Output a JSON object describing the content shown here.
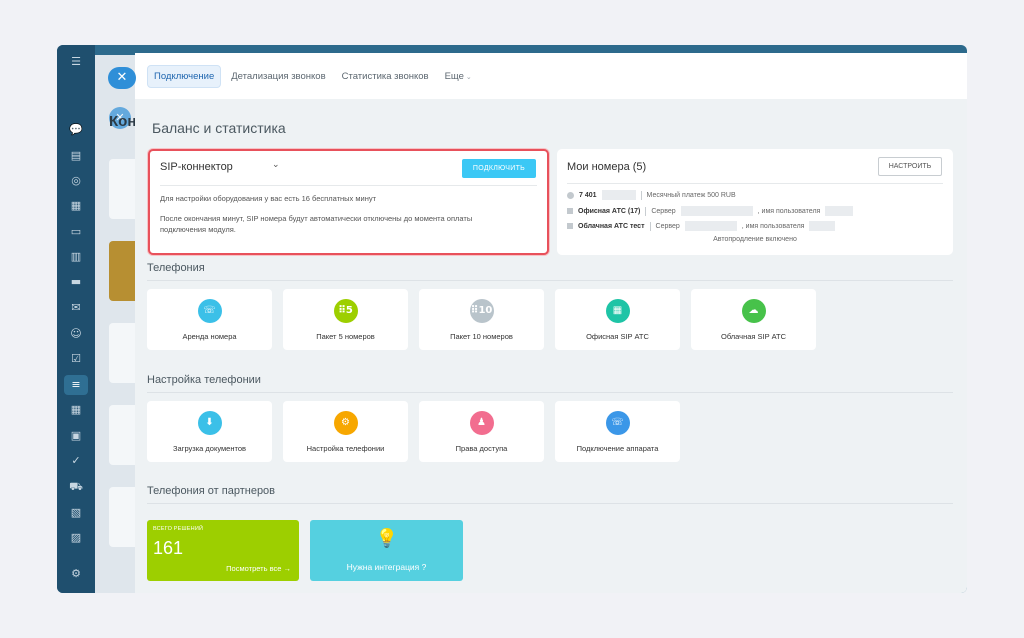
{
  "sidebar": {
    "icons": [
      "menu-icon",
      "chat-icon",
      "feed-icon",
      "target-icon",
      "calendar-icon",
      "document-icon",
      "chart-icon",
      "card-icon",
      "mail-icon",
      "contacts-icon",
      "tasks-icon",
      "telephony-icon",
      "schedule-icon",
      "store-icon",
      "tick-icon",
      "cart-icon",
      "media-icon",
      "export-icon",
      "settings-icon"
    ],
    "glyphs": [
      "☰",
      "💬",
      "▤",
      "◎",
      "▦",
      "▭",
      "▥",
      "▬",
      "✉",
      "☺",
      "☑",
      "≡",
      "▦",
      "▣",
      "✓",
      "⛟",
      "▧",
      "▨",
      "⚙"
    ]
  },
  "underlay": {
    "title": "Кон",
    "close": "✕"
  },
  "tabs": [
    {
      "label": "Подключение"
    },
    {
      "label": "Детализация звонков"
    },
    {
      "label": "Статистика звонков"
    },
    {
      "label": "Еще"
    }
  ],
  "page_title": "Баланс и статистика",
  "sip": {
    "title": "SIP-коннектор",
    "button": "ПОДКЛЮЧИТЬ",
    "line1": "Для настройки оборудования у вас есть 16 бесплатных минут",
    "line2": "После окончания минут, SIP номера будут автоматически отключены до момента оплаты подключения модуля."
  },
  "numbers": {
    "title": "Мои номера (5)",
    "button": "НАСТРОИТЬ",
    "rows": [
      {
        "name": "7 401",
        "detail": "Месячный платеж 500 RUB"
      },
      {
        "name": "Офисная АТС (17)",
        "server": "Сервер",
        "user": ", имя пользователя"
      },
      {
        "name": "Облачная АТС тест",
        "server": "Сервер",
        "user": ", имя пользователя"
      }
    ],
    "footer": "Автопродление включено"
  },
  "telephony": {
    "title": "Телефония",
    "tiles": [
      {
        "label": "Аренда номера",
        "glyph": "☏",
        "color": "#3bc0e8"
      },
      {
        "label": "Пакет 5 номеров",
        "glyph": "⠿5",
        "color": "#9dcf00"
      },
      {
        "label": "Пакет 10 номеров",
        "glyph": "⠿10",
        "color": "#b9c4cb"
      },
      {
        "label": "Офисная SIP АТС",
        "glyph": "▦",
        "color": "#1ec4a6"
      },
      {
        "label": "Облачная SIP АТС",
        "glyph": "☁",
        "color": "#47c24a"
      }
    ]
  },
  "settings": {
    "title": "Настройка телефонии",
    "tiles": [
      {
        "label": "Загрузка документов",
        "glyph": "⬇",
        "color": "#3bc0e8"
      },
      {
        "label": "Настройка телефонии",
        "glyph": "⚙",
        "color": "#f7a700"
      },
      {
        "label": "Права доступа",
        "glyph": "♟",
        "color": "#f26d8f"
      },
      {
        "label": "Подключение аппарата",
        "glyph": "☏",
        "color": "#3b97e8"
      }
    ]
  },
  "partners": {
    "title": "Телефония от партнеров",
    "total_caption": "ВСЕГО РЕШЕНИЙ",
    "total": "161",
    "view_all": "Посмотреть все →",
    "integration": "Нужна интеграция ?"
  }
}
